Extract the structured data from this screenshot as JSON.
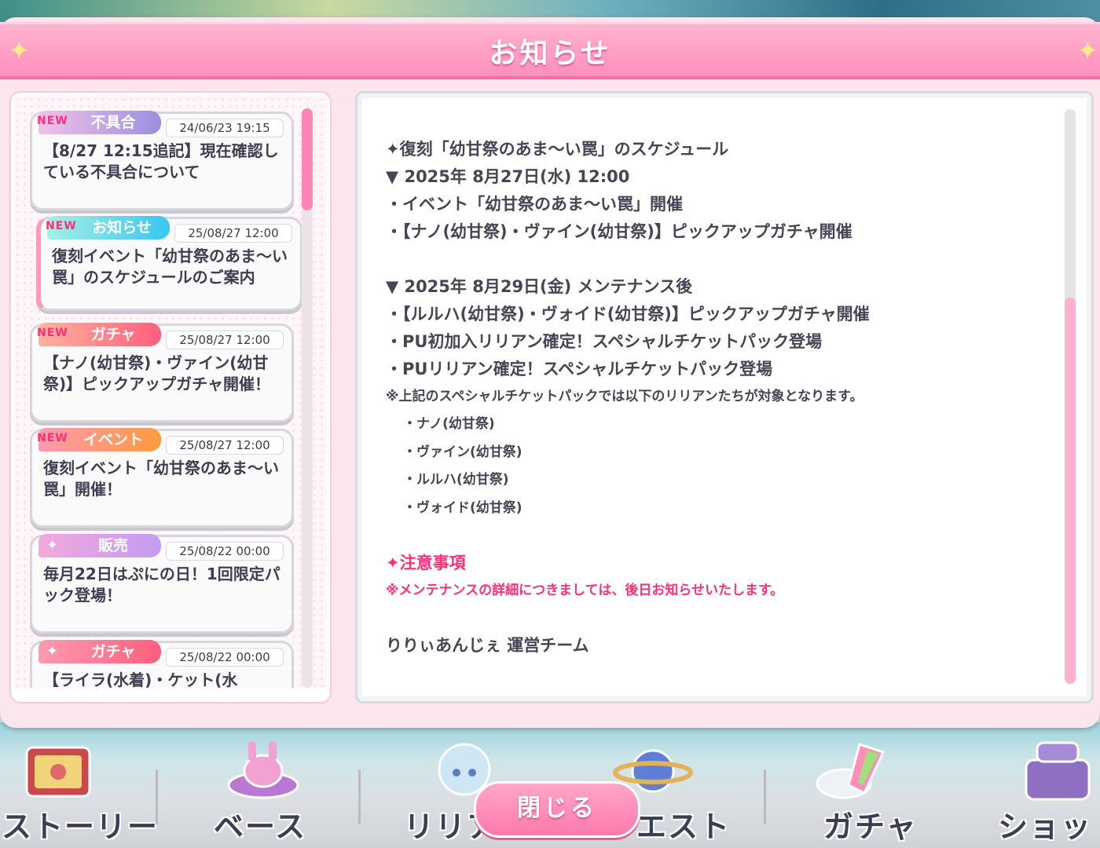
{
  "header": {
    "title": "お知らせ"
  },
  "notices": [
    {
      "new": "NEW",
      "category": "不具合",
      "date": "24/06/23 19:15",
      "text": "【8/27 12:15追記】現在確認している不具合について",
      "tag_color": "#9b8fe0"
    },
    {
      "new": "NEW",
      "category": "お知らせ",
      "date": "25/08/27 12:00",
      "text": "復刻イベント「幼甘祭のあま～い罠」のスケジュールのご案内",
      "tag_color": "#39c6f0"
    },
    {
      "new": "NEW",
      "category": "ガチャ",
      "date": "25/08/27 12:00",
      "text": "【ナノ(幼甘祭)・ヴァイン(幼甘祭)】ピックアップガチャ開催！",
      "tag_color": "#ff5f7c"
    },
    {
      "new": "NEW",
      "category": "イベント",
      "date": "25/08/27 12:00",
      "text": "復刻イベント「幼甘祭のあま～い罠」開催！",
      "tag_color": "#ff9a3c"
    },
    {
      "new": "",
      "category": "販売",
      "date": "25/08/22 00:00",
      "text": "毎月22日はぷにの日！1回限定パック登場！",
      "tag_color": "#c39cf2"
    },
    {
      "new": "",
      "category": "ガチャ",
      "date": "25/08/22 00:00",
      "text": "【ライラ(水着)・ケット(水",
      "tag_color": "#ff5f7c"
    }
  ],
  "detail": {
    "lines": [
      "✦復刻「幼甘祭のあま～い罠」のスケジュール",
      "▼ 2025年 8月27日(水) 12:00",
      "・イベント「幼甘祭のあま～い罠」開催",
      "・【ナノ(幼甘祭)・ヴァイン(幼甘祭)】ピックアップガチャ開催",
      "▼ 2025年 8月29日(金) メンテナンス後",
      "・【ルルハ(幼甘祭)・ヴォイド(幼甘祭)】ピックアップガチャ開催",
      "・PU初加入リリアン確定！スペシャルチケットパック登場",
      "・PUリリアン確定！スペシャルチケットパック登場",
      "※上記のスペシャルチケットパックでは以下のリリアンたちが対象となります。",
      "・ナノ(幼甘祭)",
      "・ヴァイン(幼甘祭)",
      "・ルルハ(幼甘祭)",
      "・ヴォイド(幼甘祭)",
      "✦注意事項",
      "※メンテナンスの詳細につきましては、後日お知らせいたします。",
      "りりぃあんじぇ 運営チーム"
    ]
  },
  "close_button": {
    "label": "閉じる"
  },
  "bottom_nav": {
    "items": [
      "ストーリー",
      "ベース",
      "リリア",
      "クエスト",
      "ガチャ",
      "ショッ"
    ]
  }
}
